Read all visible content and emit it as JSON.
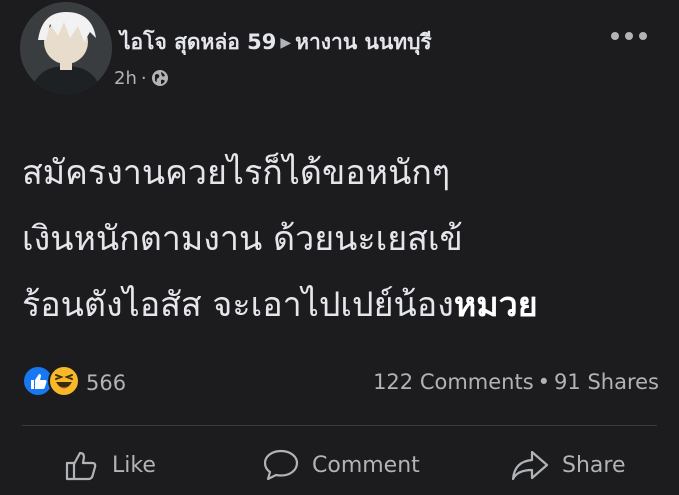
{
  "post": {
    "author_name": "ไอโจ สุดหล่อ 59",
    "group_name": "หางาน นนทบุรี",
    "timestamp": "2h",
    "privacy_icon": "globe-icon",
    "more_icon": "more-options-icon",
    "text_lines": [
      "สมัครงานควยไรก็ได้ขอหนักๆ",
      "เงินหนักตามงาน ด้วยนะเยสเข้",
      "ร้อนตังไอสัส จะเอาไปเปย์น้อง"
    ],
    "text_emphasis": "หมวย"
  },
  "reactions": {
    "icons": [
      "like-reaction-icon",
      "haha-reaction-icon"
    ],
    "count": "566"
  },
  "stats": {
    "comments": "122 Comments",
    "shares": "91 Shares"
  },
  "actions": {
    "like_label": "Like",
    "comment_label": "Comment",
    "share_label": "Share"
  },
  "colors": {
    "background": "#1c1c1e",
    "text_primary": "#e4e6eb",
    "text_secondary": "#b0b3b8",
    "like_blue": "#1877f2",
    "haha_yellow": "#f7b928"
  }
}
